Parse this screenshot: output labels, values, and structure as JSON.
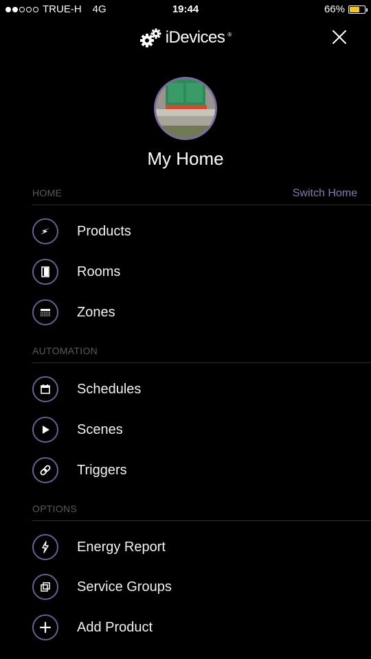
{
  "status_bar": {
    "carrier": "TRUE-H",
    "network": "4G",
    "time": "19:44",
    "battery": "66%",
    "battery_level": 0.66,
    "signal_bars_filled": 2,
    "signal_bars_total": 5
  },
  "header": {
    "brand": "iDevices",
    "brand_mark": "®"
  },
  "home": {
    "name": "My Home"
  },
  "sections": {
    "home": {
      "title": "HOME",
      "action": "Switch Home",
      "items": [
        {
          "label": "Products",
          "icon": "bolt-icon"
        },
        {
          "label": "Rooms",
          "icon": "door-icon"
        },
        {
          "label": "Zones",
          "icon": "zone-icon"
        }
      ]
    },
    "automation": {
      "title": "AUTOMATION",
      "items": [
        {
          "label": "Schedules",
          "icon": "calendar-icon"
        },
        {
          "label": "Scenes",
          "icon": "play-icon"
        },
        {
          "label": "Triggers",
          "icon": "link-icon"
        }
      ]
    },
    "options": {
      "title": "OPTIONS",
      "items": [
        {
          "label": "Energy Report",
          "icon": "energy-icon"
        },
        {
          "label": "Service Groups",
          "icon": "groups-icon"
        },
        {
          "label": "Add Product",
          "icon": "plus-icon"
        }
      ]
    }
  },
  "colors": {
    "accent": "#7b6a9e",
    "background": "#000000",
    "section_header": "#5a5a5a",
    "battery": "#f5c518"
  }
}
